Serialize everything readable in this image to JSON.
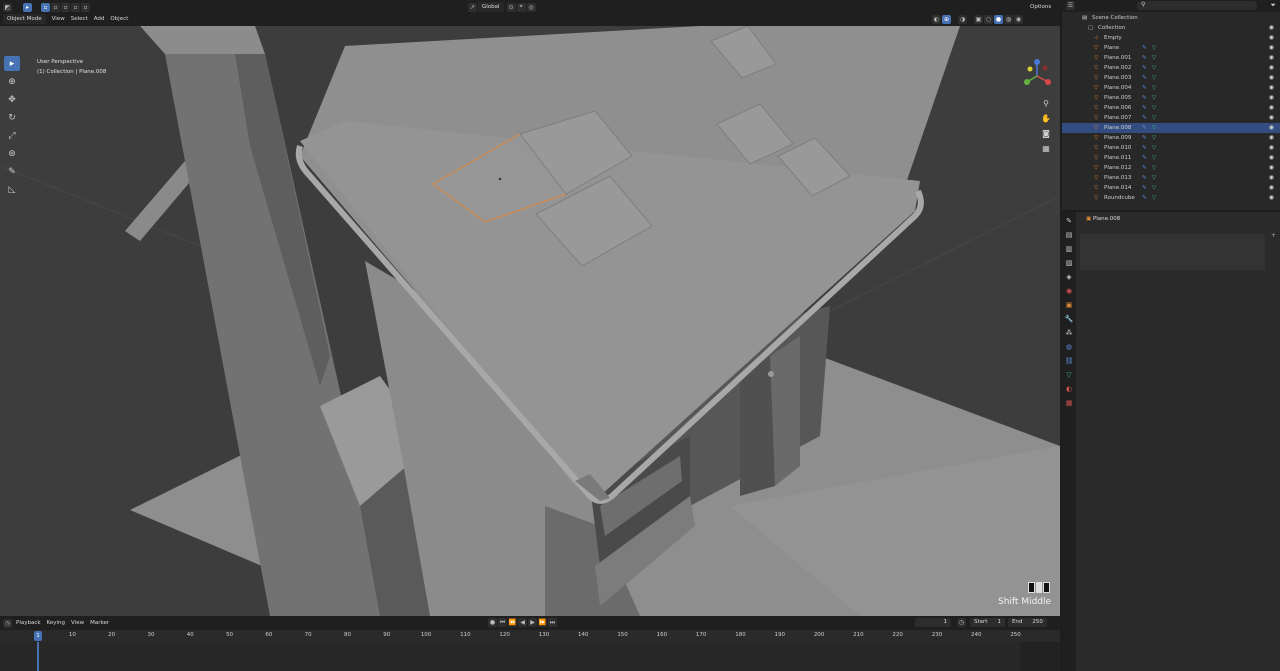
{
  "header": {
    "mode_label": "Object Mode",
    "menu": [
      "View",
      "Select",
      "Add",
      "Object"
    ],
    "orientation_label": "Global",
    "options_label": "Options"
  },
  "viewport": {
    "view_name": "User Perspective",
    "collection_path": "(1) Collection | Plane.008",
    "overlay_text": "Shift Middle",
    "tools": [
      "select-box-icon",
      "cursor-icon",
      "move-icon",
      "rotate-icon",
      "scale-icon",
      "transform-icon",
      "annotate-icon",
      "measure-icon"
    ],
    "nav_icons": [
      "zoom-icon",
      "hand-icon",
      "camera-icon",
      "grid-icon"
    ]
  },
  "timeline": {
    "menu": [
      "Playback",
      "Keying",
      "View",
      "Marker"
    ],
    "current_frame": "1",
    "start_label": "Start",
    "start_value": "1",
    "end_label": "End",
    "end_value": "250",
    "playhead_label": "1",
    "ticks": [
      "10",
      "20",
      "30",
      "40",
      "50",
      "60",
      "70",
      "80",
      "90",
      "100",
      "110",
      "120",
      "130",
      "140",
      "150",
      "160",
      "170",
      "180",
      "190",
      "200",
      "210",
      "220",
      "230",
      "240",
      "250"
    ]
  },
  "outliner": {
    "items": [
      {
        "name": "Scene Collection",
        "type": "scene",
        "level": 0
      },
      {
        "name": "Collection",
        "type": "collection",
        "level": 1
      },
      {
        "name": "Empty",
        "type": "empty",
        "level": 2
      },
      {
        "name": "Plane",
        "type": "mesh",
        "level": 2
      },
      {
        "name": "Plane.001",
        "type": "mesh",
        "level": 2
      },
      {
        "name": "Plane.002",
        "type": "mesh",
        "level": 2
      },
      {
        "name": "Plane.003",
        "type": "mesh",
        "level": 2
      },
      {
        "name": "Plane.004",
        "type": "mesh",
        "level": 2
      },
      {
        "name": "Plane.005",
        "type": "mesh",
        "level": 2
      },
      {
        "name": "Plane.006",
        "type": "mesh",
        "level": 2
      },
      {
        "name": "Plane.007",
        "type": "mesh",
        "level": 2
      },
      {
        "name": "Plane.008",
        "type": "mesh",
        "level": 2,
        "selected": true
      },
      {
        "name": "Plane.009",
        "type": "mesh",
        "level": 2
      },
      {
        "name": "Plane.010",
        "type": "mesh",
        "level": 2
      },
      {
        "name": "Plane.011",
        "type": "mesh",
        "level": 2
      },
      {
        "name": "Plane.012",
        "type": "mesh",
        "level": 2
      },
      {
        "name": "Plane.013",
        "type": "mesh",
        "level": 2
      },
      {
        "name": "Plane.014",
        "type": "mesh",
        "level": 2
      },
      {
        "name": "Roundcube",
        "type": "mesh",
        "level": 2
      }
    ]
  },
  "properties": {
    "object_name": "Plane.008"
  },
  "colors": {
    "accent": "#4772b3",
    "selection_outline": "#e0893a",
    "mesh_icon": "#e0893a",
    "data_icon": "#3fb88c"
  }
}
